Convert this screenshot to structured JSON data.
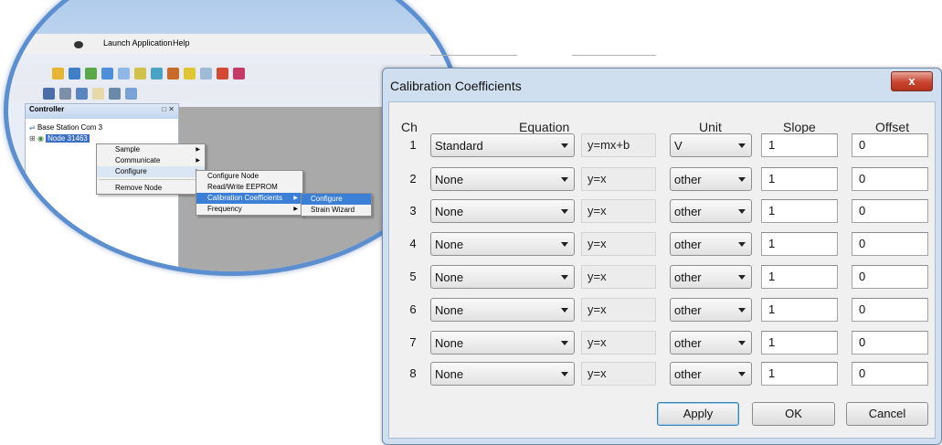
{
  "app": {
    "menu": {
      "launch_application": "Launch Application",
      "help": "Help"
    },
    "controller": {
      "title": "Controller",
      "pin_close": "□ ✕",
      "base_station": "Base Station Com 3",
      "node": "Node 31463"
    },
    "context_menu": {
      "items": [
        "Sample",
        "Communicate",
        "Configure",
        "Remove Node"
      ]
    },
    "configure_submenu": {
      "items": [
        "Configure Node",
        "Read/Write EEPROM",
        "Calibration Coefficients",
        "Frequency"
      ]
    },
    "calibration_submenu": {
      "items": [
        "Configure",
        "Strain Wizard"
      ]
    }
  },
  "dialog": {
    "title": "Calibration Coefficients",
    "close_label": "x",
    "headers": {
      "ch": "Ch",
      "equation": "Equation",
      "unit": "Unit",
      "slope": "Slope",
      "offset": "Offset"
    },
    "rows": [
      {
        "ch": "1",
        "equation": "Standard",
        "formula": "y=mx+b",
        "unit": "V",
        "slope": "1",
        "offset": "0"
      },
      {
        "ch": "2",
        "equation": "None",
        "formula": "y=x",
        "unit": "other",
        "slope": "1",
        "offset": "0"
      },
      {
        "ch": "3",
        "equation": "None",
        "formula": "y=x",
        "unit": "other",
        "slope": "1",
        "offset": "0"
      },
      {
        "ch": "4",
        "equation": "None",
        "formula": "y=x",
        "unit": "other",
        "slope": "1",
        "offset": "0"
      },
      {
        "ch": "5",
        "equation": "None",
        "formula": "y=x",
        "unit": "other",
        "slope": "1",
        "offset": "0"
      },
      {
        "ch": "6",
        "equation": "None",
        "formula": "y=x",
        "unit": "other",
        "slope": "1",
        "offset": "0"
      },
      {
        "ch": "7",
        "equation": "None",
        "formula": "y=x",
        "unit": "other",
        "slope": "1",
        "offset": "0"
      },
      {
        "ch": "8",
        "equation": "None",
        "formula": "y=x",
        "unit": "other",
        "slope": "1",
        "offset": "0"
      }
    ],
    "buttons": {
      "apply": "Apply",
      "ok": "OK",
      "cancel": "Cancel"
    }
  }
}
